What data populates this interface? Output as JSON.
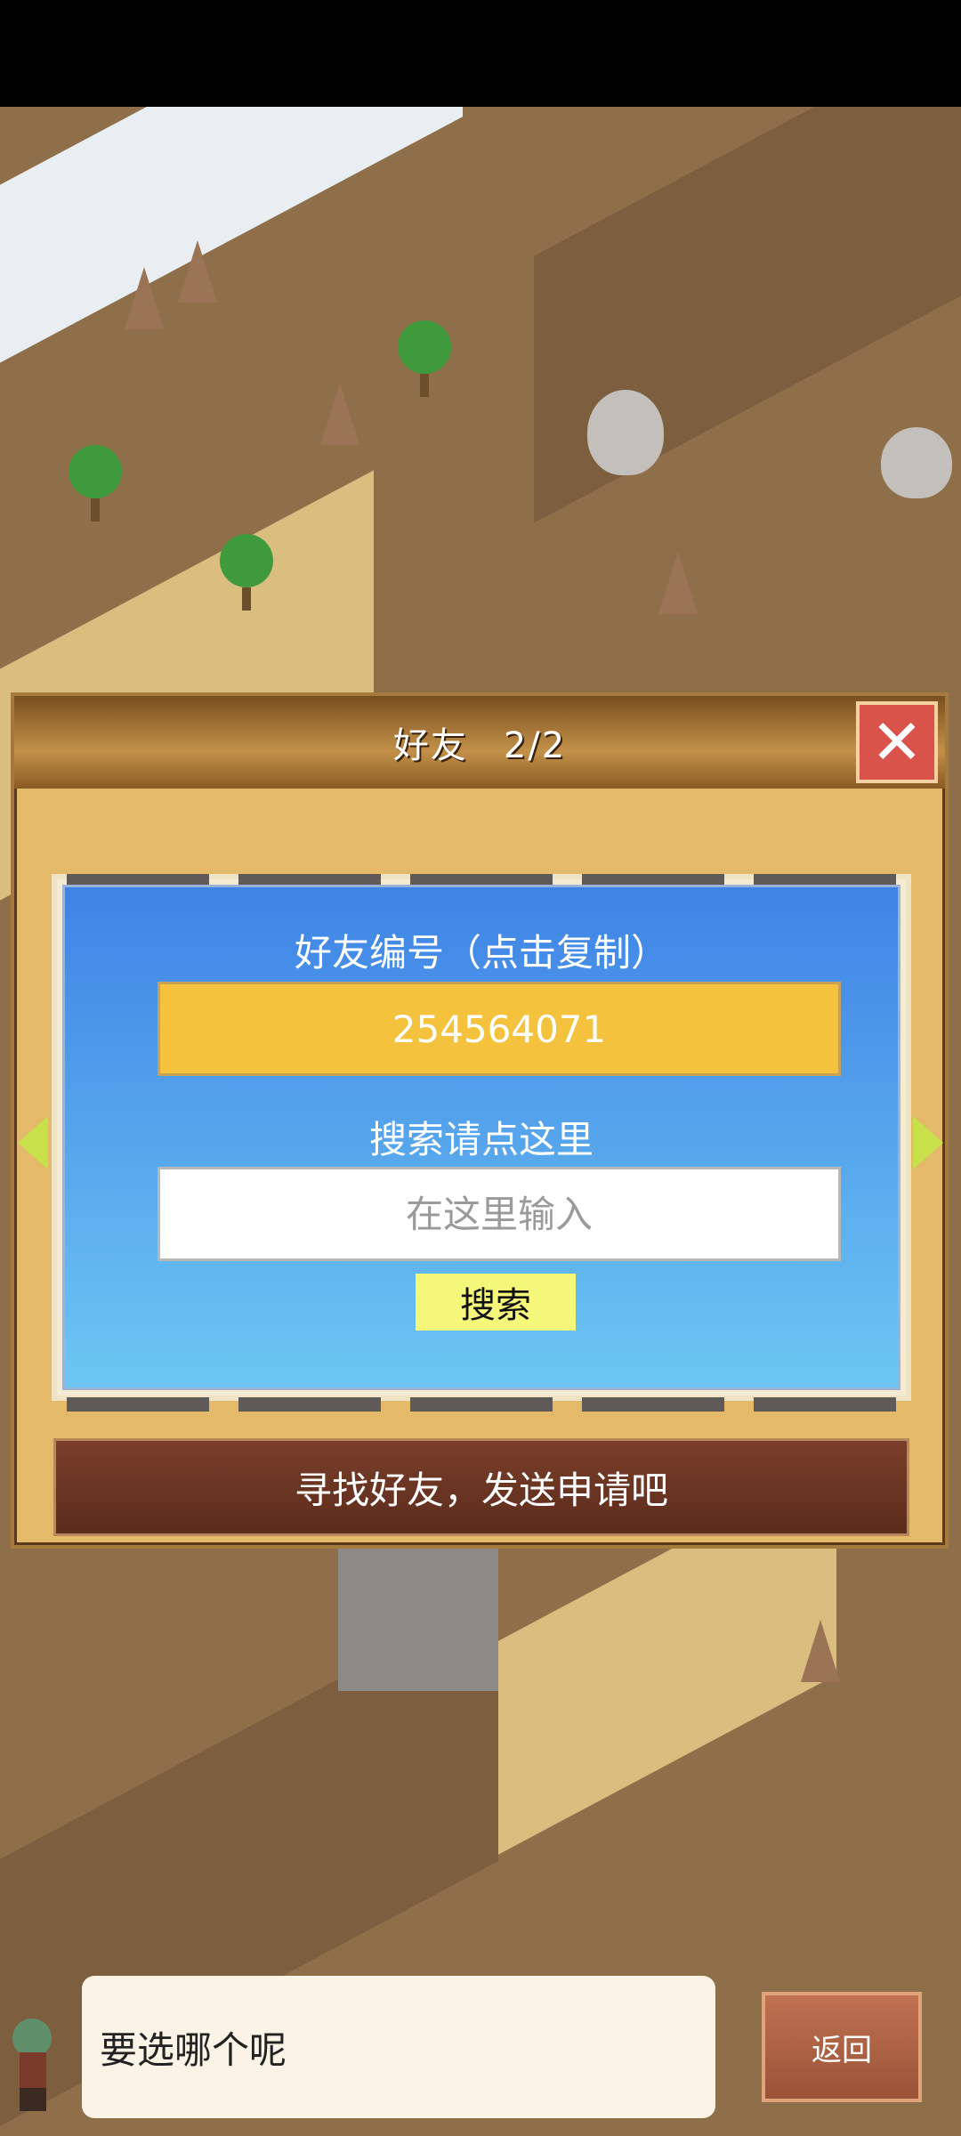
{
  "dialog": {
    "title": "好友",
    "count": "2/2",
    "close_icon": "close-x-icon"
  },
  "friend_card": {
    "id_label": "好友编号（点击复制）",
    "id_value": "254564071",
    "search_label": "搜索请点这里",
    "search_placeholder": "在这里输入",
    "search_button": "搜索"
  },
  "find_banner": "寻找好友，发送申请吧",
  "bottom": {
    "speech": "要选哪个呢",
    "back_button": "返回"
  },
  "colors": {
    "card_top": "#3f83e6",
    "card_bottom": "#6dc6f2",
    "id_box": "#f4c23c",
    "search_button": "#f5f77a",
    "close_button": "#d9534a",
    "banner": "#6a3322"
  }
}
